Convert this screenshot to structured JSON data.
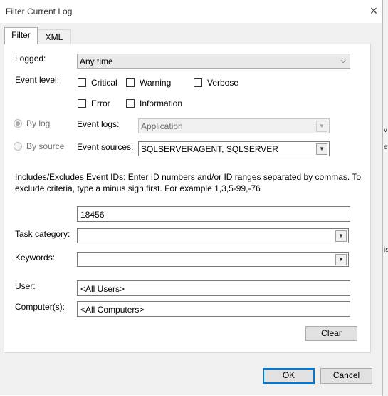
{
  "dialog": {
    "title": "Filter Current Log",
    "close_glyph": "×"
  },
  "tabs": [
    {
      "label": "Filter",
      "selected": true
    },
    {
      "label": "XML",
      "selected": false
    }
  ],
  "filter": {
    "logged": {
      "label": "Logged:",
      "value": "Any time"
    },
    "event_level": {
      "label": "Event level:",
      "options": [
        {
          "label": "Critical",
          "checked": false
        },
        {
          "label": "Warning",
          "checked": false
        },
        {
          "label": "Verbose",
          "checked": false
        },
        {
          "label": "Error",
          "checked": false
        },
        {
          "label": "Information",
          "checked": false
        }
      ]
    },
    "by_log": {
      "label": "By log",
      "selected": true,
      "enabled": false
    },
    "by_source": {
      "label": "By source",
      "selected": false,
      "enabled": false
    },
    "event_logs": {
      "label": "Event logs:",
      "value": "Application",
      "enabled": false
    },
    "event_sources": {
      "label": "Event sources:",
      "value": "SQLSERVERAGENT, SQLSERVER"
    },
    "event_ids": {
      "description": "Includes/Excludes Event IDs: Enter ID numbers and/or ID ranges separated by commas. To exclude criteria, type a minus sign first. For example 1,3,5-99,-76",
      "value": "18456"
    },
    "task_category": {
      "label": "Task category:",
      "value": ""
    },
    "keywords": {
      "label": "Keywords:",
      "value": ""
    },
    "user": {
      "label": "User:",
      "value": "<All Users>"
    },
    "computers": {
      "label": "Computer(s):",
      "value": "<All Computers>"
    },
    "clear_label": "Clear"
  },
  "footer": {
    "ok_label": "OK",
    "cancel_label": "Cancel"
  },
  "background_window": {
    "fragments": [
      "v",
      "ev",
      "is"
    ]
  },
  "icons": {
    "dropdown_arrow": "▼"
  },
  "colors": {
    "dialog_bg": "#f0f0f0",
    "panel_bg": "#ffffff",
    "default_button_border": "#0078d7"
  }
}
